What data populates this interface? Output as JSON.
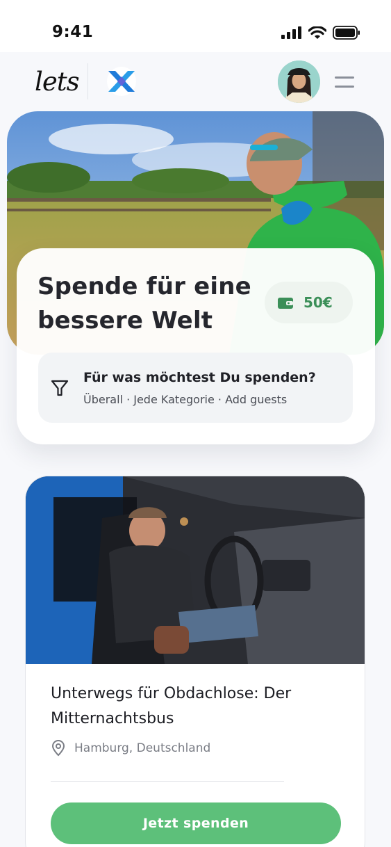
{
  "status_bar": {
    "time": "9:41"
  },
  "header": {
    "logo_text": "lets"
  },
  "hero": {
    "title": "Spende für eine bessere Welt",
    "wallet_amount": "50€",
    "search": {
      "title": "Für was möchtest Du spenden?",
      "subtitle": "Überall · Jede Kategorie · Add guests"
    }
  },
  "project": {
    "title": "Unterwegs für Obdachlose: Der Mitternachtsbus",
    "location": "Hamburg, Deutschland",
    "donate_label": "Jetzt spenden"
  },
  "colors": {
    "accent_green": "#5dc07a",
    "wallet_green": "#3b8f58",
    "partner_logo_blue": "#1f7bd9"
  },
  "icons": [
    "signal-icon",
    "wifi-icon",
    "battery-icon",
    "menu-icon",
    "wallet-icon",
    "filter-icon",
    "location-pin-icon"
  ]
}
